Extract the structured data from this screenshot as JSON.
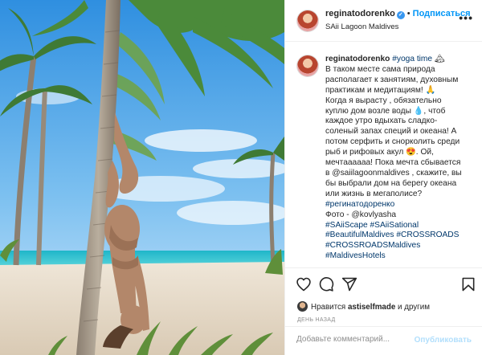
{
  "post": {
    "username": "reginatodorenko",
    "verified_mark": "✓",
    "separator": "•",
    "follow_label": "Подписаться",
    "location": "SAii Lagoon Maldives",
    "more_label": "•••"
  },
  "caption": {
    "username": "reginatodorenko",
    "first_tag": "#yoga time",
    "first_emoji": "🏔",
    "lines": [
      "В таком месте сама природа",
      "располагает к занятиям, духовным",
      "практикам и медитациям! 🙏",
      "Когда я вырасту , обязательно",
      "куплю дом возле воды 💧, чтоб",
      "каждое утро вдыхать сладко-",
      "соленый запах специй и океана! А",
      "потом серфить и снорколить среди",
      "рыб и рифовых акул 😍. Ой,",
      "мечтаааааа! Пока мечта сбывается",
      "в @saiilagoonmaldives , скажите, вы",
      "бы выбрали дом на берегу океана",
      "или жизнь в мегаполисе?"
    ],
    "tags": [
      "#регинатодоренко",
      "Фото - @kovlyasha",
      "#SAiiScape #SAiiSational",
      "#BeautifulMaldives #CROSSROADS",
      "#CROSSROADSMaldives",
      "#MaldivesHotels"
    ]
  },
  "actions": {
    "icons": [
      "heart-icon",
      "comment-icon",
      "share-icon",
      "bookmark-icon"
    ],
    "likes_prefix": "Нравится ",
    "likes_user": "astiselfmade",
    "likes_suffix": " и другим",
    "time": "День назад"
  },
  "comment": {
    "placeholder": "Добавьте комментарий...",
    "publish_label": "Опубликовать"
  },
  "colors": {
    "follow": "#0095f6",
    "verified": "#3897f0",
    "tag": "#00376b",
    "muted": "#8e8e8e",
    "publish_disabled": "#b2dffc",
    "border": "#efefef"
  }
}
